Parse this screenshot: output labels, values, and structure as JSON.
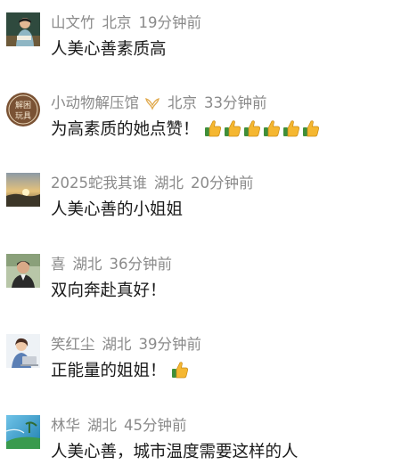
{
  "comments": [
    {
      "user": "山文竹",
      "location": "北京",
      "time": "19分钟前",
      "text": "人美心善素质高",
      "avatar_icon": "person-reading-avatar"
    },
    {
      "user": "小动物解压馆",
      "location": "北京",
      "time": "33分钟前",
      "text": "为高素质的她点赞！",
      "badge_icon": "gold-badge-icon",
      "emoji_icon": "thumbs-up-icon",
      "emoji_count": 6,
      "avatar_icon": "seal-avatar",
      "avatar_text": "解困玩具"
    },
    {
      "user": "2025蛇我其谁",
      "location": "湖北",
      "time": "20分钟前",
      "text": "人美心善的小姐姐",
      "avatar_icon": "sunset-landscape-avatar"
    },
    {
      "user": "喜",
      "location": "湖北",
      "time": "36分钟前",
      "text": "双向奔赴真好！",
      "avatar_icon": "man-portrait-avatar"
    },
    {
      "user": "笑红尘",
      "location": "湖北",
      "time": "39分钟前",
      "text": "正能量的姐姐！",
      "emoji_icon": "thumbs-up-icon",
      "emoji_count": 1,
      "avatar_icon": "woman-laptop-avatar"
    },
    {
      "user": "林华",
      "location": "湖北",
      "time": "45分钟前",
      "text": "人美心善，城市温度需要这样的人",
      "avatar_icon": "beach-landscape-avatar"
    }
  ]
}
